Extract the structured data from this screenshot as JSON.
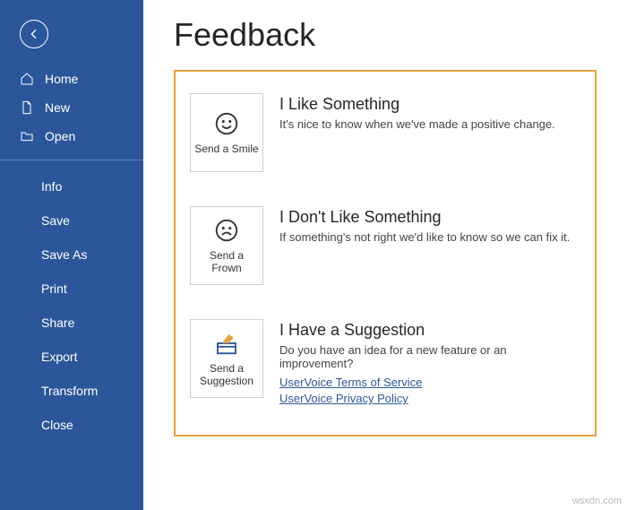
{
  "sidebar": {
    "primary": [
      {
        "name": "home",
        "label": "Home",
        "icon": "home-icon"
      },
      {
        "name": "new",
        "label": "New",
        "icon": "page-icon"
      },
      {
        "name": "open",
        "label": "Open",
        "icon": "folder-icon"
      }
    ],
    "secondary": [
      {
        "name": "info",
        "label": "Info"
      },
      {
        "name": "save",
        "label": "Save"
      },
      {
        "name": "saveas",
        "label": "Save As"
      },
      {
        "name": "print",
        "label": "Print"
      },
      {
        "name": "share",
        "label": "Share"
      },
      {
        "name": "export",
        "label": "Export"
      },
      {
        "name": "transform",
        "label": "Transform"
      },
      {
        "name": "close",
        "label": "Close"
      }
    ]
  },
  "page": {
    "title": "Feedback",
    "items": [
      {
        "tile": "Send a Smile",
        "title": "I Like Something",
        "desc": "It's nice to know when we've made a positive change.",
        "links": []
      },
      {
        "tile": "Send a Frown",
        "title": "I Don't Like Something",
        "desc": "If something's not right we'd like to know so we can fix it.",
        "links": []
      },
      {
        "tile": "Send a Suggestion",
        "title": "I Have a Suggestion",
        "desc": "Do you have an idea for a new feature or an improvement?",
        "links": [
          "UserVoice Terms of Service",
          "UserVoice Privacy Policy"
        ]
      }
    ]
  },
  "watermark": "wsxdn.com"
}
